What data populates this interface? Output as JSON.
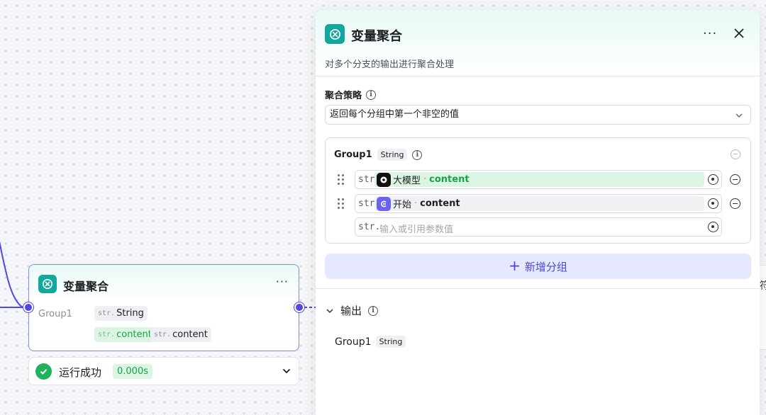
{
  "canvas": {
    "node": {
      "title": "变量聚合",
      "more": "···",
      "group_label": "Group1",
      "type_prefix": "str.",
      "type_value": "String",
      "var_source_prefix": "str.",
      "var_source": "content",
      "var_name_prefix": "str.",
      "var_name": "content"
    },
    "run": {
      "status": "运行成功",
      "time": "0.000s"
    },
    "edge_node_mark": "符"
  },
  "panel": {
    "title": "变量聚合",
    "more": "···",
    "description": "对多个分支的输出进行聚合处理",
    "strategy_label": "聚合策略",
    "strategy_value": "返回每个分组中第一个非空的值",
    "group": {
      "name": "Group1",
      "type": "String",
      "rows": [
        {
          "prefix": "str.",
          "source": "大模型",
          "sep": "·",
          "var": "content"
        },
        {
          "prefix": "str.",
          "source": "开始",
          "sep": "·",
          "var": "content"
        }
      ],
      "empty_row": {
        "prefix": "str.",
        "placeholder": "输入或引用参数值"
      }
    },
    "add_group_label": "新增分组",
    "output": {
      "label": "输出",
      "item_name": "Group1",
      "item_type": "String"
    }
  },
  "colors": {
    "accent": "#5147e5",
    "teal": "#13a89e",
    "success": "#1fb35a",
    "success_bg": "#dcf5e3"
  }
}
